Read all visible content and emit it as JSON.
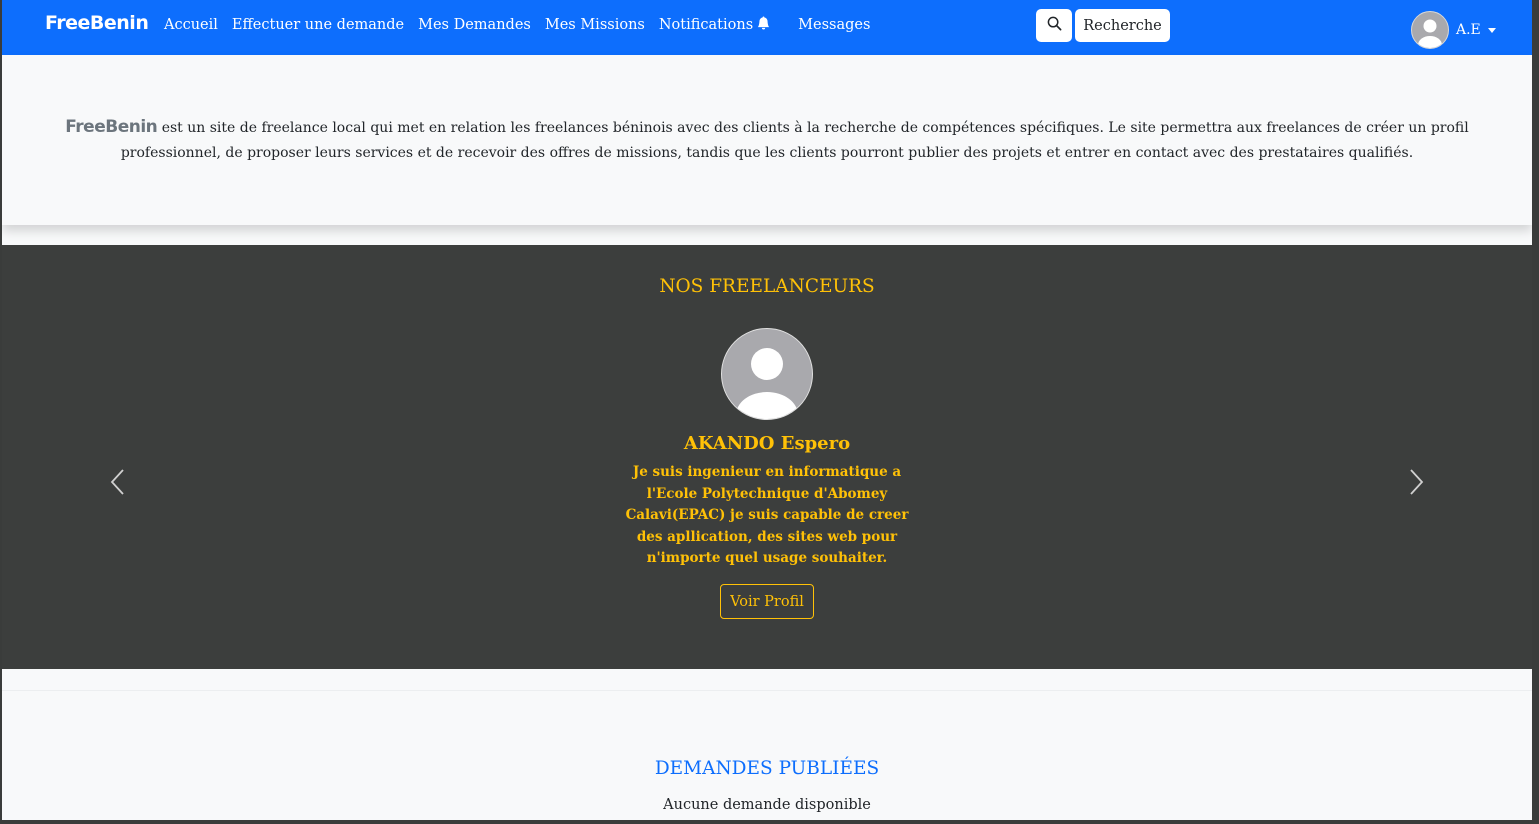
{
  "navbar": {
    "brand": "FreeBenin",
    "links": [
      {
        "label": "Accueil"
      },
      {
        "label": "Effectuer une demande"
      },
      {
        "label": "Mes Demandes"
      },
      {
        "label": "Mes Missions"
      },
      {
        "label": "Notifications"
      },
      {
        "label": "Messages"
      }
    ],
    "search_icon": "search-icon",
    "search_button": "Recherche",
    "user_initials": "A.E",
    "bg_color": "#0d6efd"
  },
  "intro": {
    "brand": "FreeBenin",
    "text": " est un site de freelance local qui met en relation les freelances béninois avec des clients à la recherche de compétences spécifiques. Le site permettra aux freelances de créer un profil professionnel, de proposer leurs services et de recevoir des offres de missions, tandis que les clients pourront publier des projets et entrer en contact avec des prestataires qualifiés."
  },
  "freelancers": {
    "title": "NOS FREELANCEURS",
    "accent_color": "#ffc107",
    "current": {
      "name": "AKANDO Espero",
      "description": "Je suis ingenieur en informatique a l'Ecole Polytechnique d'Abomey Calavi(EPAC) je suis capable de creer des apllication, des sites web pour n'importe quel usage souhaiter.",
      "button": "Voir Profil"
    }
  },
  "demandes": {
    "title": "DEMANDES PUBLIÉES",
    "empty": "Aucune demande disponible"
  }
}
